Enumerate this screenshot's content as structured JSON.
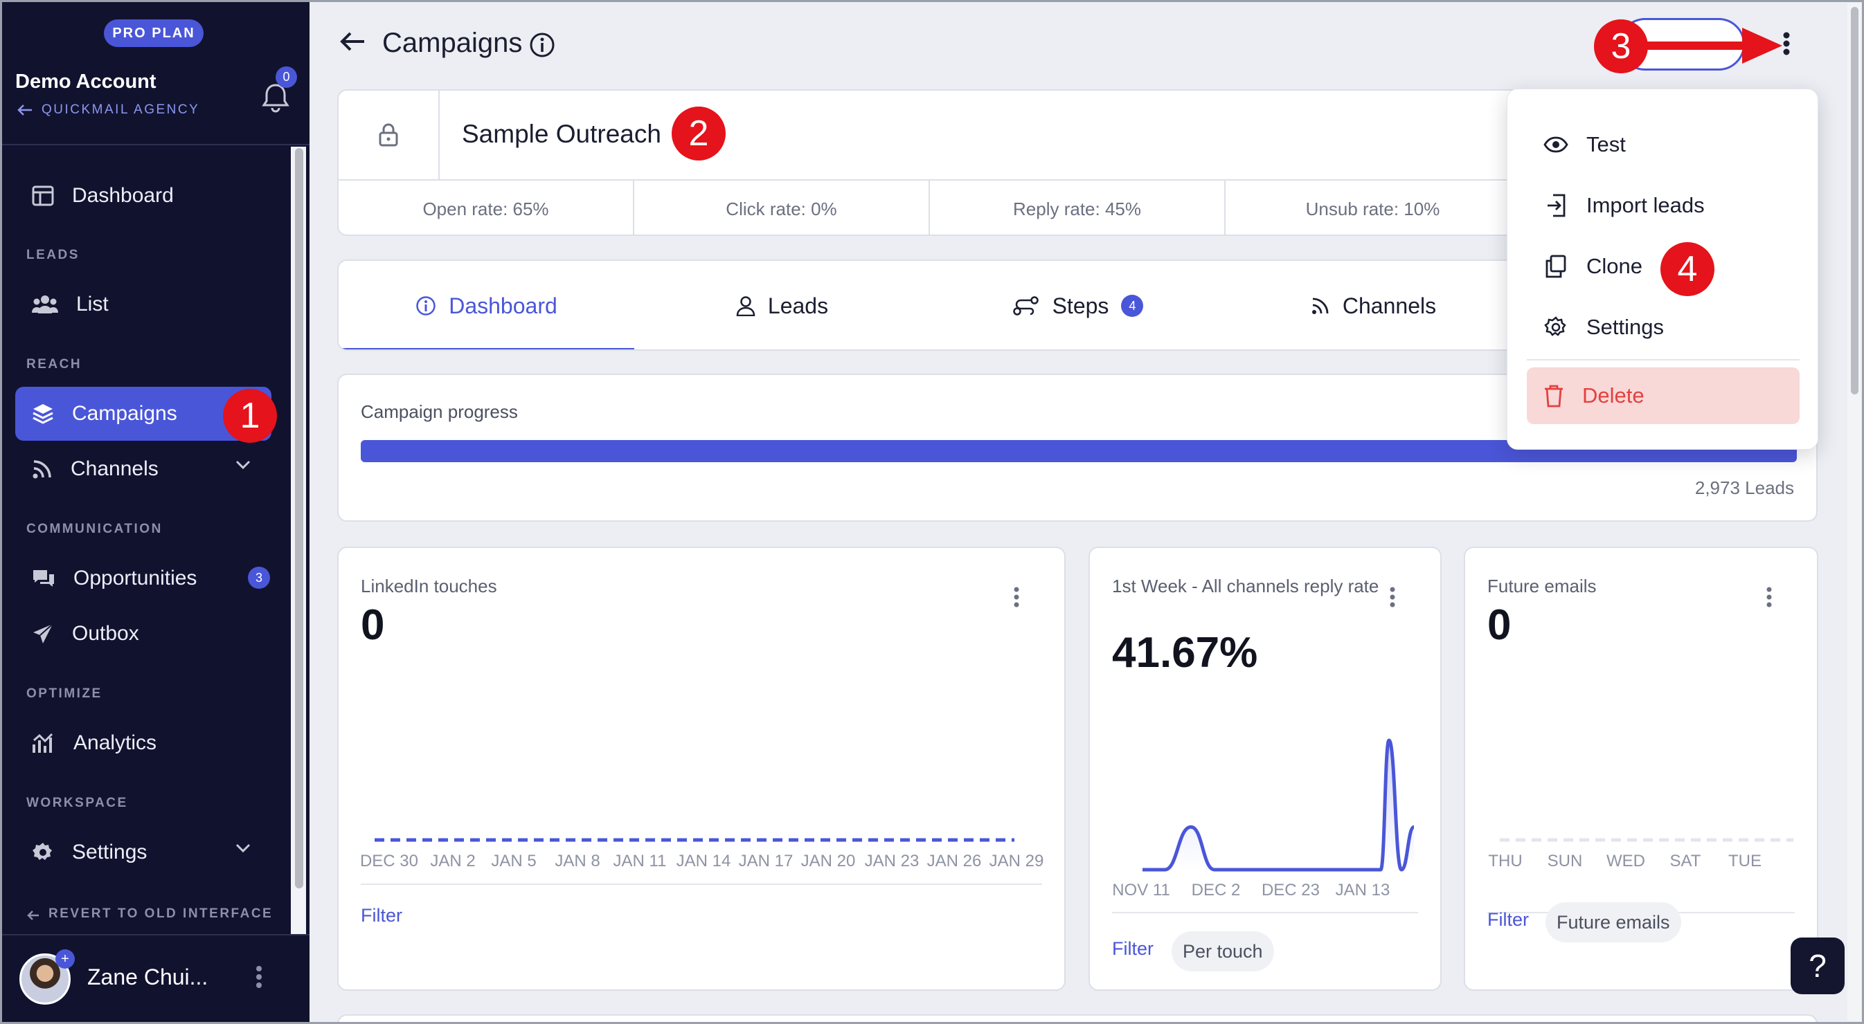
{
  "sidebar": {
    "plan_badge": "PRO PLAN",
    "account_name": "Demo Account",
    "agency_link": "QUICKMAIL AGENCY",
    "notifications_count": "0",
    "items": {
      "dashboard": "Dashboard",
      "list": "List",
      "campaigns": "Campaigns",
      "channels": "Channels",
      "opportunities": "Opportunities",
      "opportunities_count": "3",
      "outbox": "Outbox",
      "analytics": "Analytics",
      "settings": "Settings"
    },
    "sections": {
      "leads": "LEADS",
      "reach": "REACH",
      "communication": "COMMUNICATION",
      "optimize": "OPTIMIZE",
      "workspace": "WORKSPACE"
    },
    "revert": "REVERT TO OLD INTERFACE",
    "user_name": "Zane Chui..."
  },
  "header": {
    "title": "Campaigns"
  },
  "campaign": {
    "name": "Sample Outreach",
    "stats": [
      "Open rate: 65%",
      "Click rate: 0%",
      "Reply rate: 45%",
      "Unsub rate: 10%"
    ]
  },
  "tabs": {
    "dashboard": "Dashboard",
    "leads": "Leads",
    "steps": "Steps",
    "steps_count": "4",
    "channels": "Channels"
  },
  "progress": {
    "label": "Campaign progress",
    "fraction": 1.0,
    "leads": "2,973 Leads"
  },
  "widgets": {
    "linkedin": {
      "title": "LinkedIn touches",
      "value": "0",
      "filter": "Filter"
    },
    "reply_rate": {
      "title": "1st Week - All channels reply rate",
      "value": "41.67%",
      "filter": "Filter",
      "chip": "Per touch"
    },
    "future_emails": {
      "title": "Future emails",
      "value": "0",
      "filter": "Filter",
      "chip": "Future emails"
    }
  },
  "chart_data": [
    {
      "type": "line",
      "title": "LinkedIn touches",
      "x": [
        "DEC 30",
        "JAN 2",
        "JAN 5",
        "JAN 8",
        "JAN 11",
        "JAN 14",
        "JAN 17",
        "JAN 20",
        "JAN 23",
        "JAN 26",
        "JAN 29"
      ],
      "values": [
        0,
        0,
        0,
        0,
        0,
        0,
        0,
        0,
        0,
        0,
        0
      ],
      "color": "#4a56d8",
      "style": "dashed"
    },
    {
      "type": "area",
      "title": "1st Week - All channels reply rate",
      "x": [
        "NOV 11",
        "DEC 2",
        "DEC 23",
        "JAN 13"
      ],
      "values": [
        0,
        0,
        33,
        0,
        0,
        0,
        0,
        0,
        0,
        0,
        100,
        0,
        33
      ],
      "color": "#4a56d8"
    },
    {
      "type": "line",
      "title": "Future emails",
      "x": [
        "THU",
        "SUN",
        "WED",
        "SAT",
        "TUE"
      ],
      "values": [
        0,
        0,
        0,
        0,
        0,
        0,
        0,
        0,
        0,
        0,
        0,
        0,
        0,
        0,
        0,
        0,
        0,
        0,
        0,
        0
      ],
      "color": "#e3e5ee",
      "style": "dashed"
    }
  ],
  "menu": {
    "test": "Test",
    "import_leads": "Import leads",
    "clone": "Clone",
    "settings": "Settings",
    "delete": "Delete"
  },
  "annotations": [
    "1",
    "2",
    "3",
    "4"
  ],
  "help": "?",
  "colors": {
    "accent": "#4a56d8",
    "sidebar": "#11122e",
    "danger": "#e2413f",
    "annotation": "#e5131b"
  }
}
